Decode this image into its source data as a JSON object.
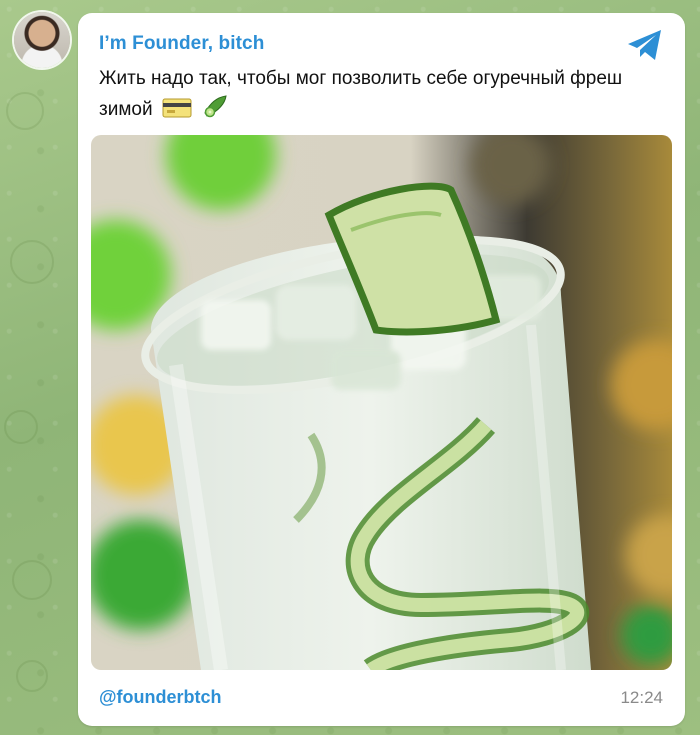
{
  "post": {
    "channel_name": "I’m Founder, bitch",
    "text": "Жить надо так, чтобы мог позволить себе огуречный фреш зимой",
    "emojis": [
      "credit-card-icon",
      "cucumber-icon"
    ],
    "link": "@founderbtch",
    "time": "12:24"
  },
  "colors": {
    "accent": "#2d8fd5",
    "background": "#9dbf80",
    "card": "#ffffff",
    "time": "#8a8a8a"
  }
}
